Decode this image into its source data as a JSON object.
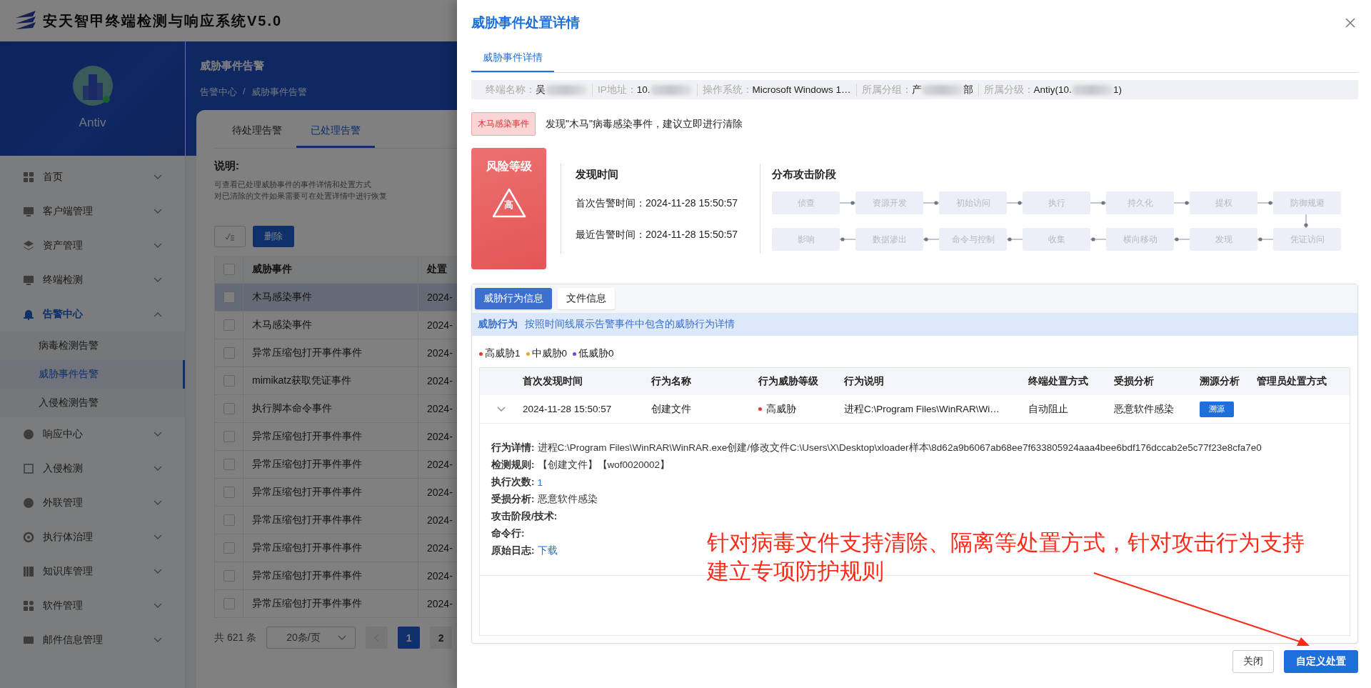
{
  "app": {
    "title": "安天智甲终端检测与响应系统V5.0",
    "user": "Antiv"
  },
  "sidebar": {
    "items": [
      {
        "label": "首页",
        "expanded": false,
        "selected": false
      },
      {
        "label": "客户端管理",
        "expanded": false,
        "selected": false
      },
      {
        "label": "资产管理",
        "expanded": false,
        "selected": false
      },
      {
        "label": "终端检测",
        "expanded": false,
        "selected": false
      },
      {
        "label": "告警中心",
        "expanded": true,
        "selected": true,
        "children": [
          {
            "label": "病毒检测告警",
            "selected": false
          },
          {
            "label": "威胁事件告警",
            "selected": true
          },
          {
            "label": "入侵检测告警",
            "selected": false
          }
        ]
      },
      {
        "label": "响应中心",
        "expanded": false,
        "selected": false
      },
      {
        "label": "入侵检测",
        "expanded": false,
        "selected": false
      },
      {
        "label": "外联管理",
        "expanded": false,
        "selected": false
      },
      {
        "label": "执行体治理",
        "expanded": false,
        "selected": false
      },
      {
        "label": "知识库管理",
        "expanded": false,
        "selected": false
      },
      {
        "label": "软件管理",
        "expanded": false,
        "selected": false
      },
      {
        "label": "邮件信息管理",
        "expanded": false,
        "selected": false
      }
    ]
  },
  "page": {
    "title": "威胁事件告警",
    "breadcrumb": [
      "告警中心",
      "威胁事件告警"
    ],
    "breadcrumb_separator": "/",
    "tabs": [
      {
        "label": "待处理告警",
        "selected": false
      },
      {
        "label": "已处理告警",
        "selected": true
      }
    ],
    "note_title": "说明:",
    "note_lines": [
      "可查看已处理威胁事件的事件详情和处置方式",
      "对已清除的文件如果需要可在处置详情中进行恢复"
    ],
    "delete_button": "删除",
    "table": {
      "columns": [
        "威胁事件",
        "处置"
      ],
      "all_checked": false,
      "rows": [
        {
          "event": "木马感染事件",
          "time": "2024-",
          "checked": false,
          "hovered": true
        },
        {
          "event": "木马感染事件",
          "time": "2024-",
          "checked": false,
          "hovered": false
        },
        {
          "event": "异常压缩包打开事件事件",
          "time": "2024-",
          "checked": false,
          "hovered": false
        },
        {
          "event": "mimikatz获取凭证事件",
          "time": "2024-",
          "checked": false,
          "hovered": false
        },
        {
          "event": "执行脚本命令事件",
          "time": "2024-",
          "checked": false,
          "hovered": false
        },
        {
          "event": "异常压缩包打开事件事件",
          "time": "2024-",
          "checked": false,
          "hovered": false
        },
        {
          "event": "异常压缩包打开事件事件",
          "time": "2024-",
          "checked": false,
          "hovered": false
        },
        {
          "event": "异常压缩包打开事件事件",
          "time": "2024-",
          "checked": false,
          "hovered": false
        },
        {
          "event": "异常压缩包打开事件事件",
          "time": "2024-",
          "checked": false,
          "hovered": false
        },
        {
          "event": "异常压缩包打开事件事件",
          "time": "2024-",
          "checked": false,
          "hovered": false
        },
        {
          "event": "异常压缩包打开事件事件",
          "time": "2024-",
          "checked": false,
          "hovered": false
        },
        {
          "event": "异常压缩包打开事件事件",
          "time": "2024-",
          "checked": false,
          "hovered": false
        }
      ]
    },
    "pagination": {
      "total": "共 621 条",
      "page_size": "20条/页",
      "pages": [
        {
          "label": "1",
          "selected": true
        },
        {
          "label": "2",
          "selected": false
        }
      ]
    }
  },
  "drawer": {
    "title": "威胁事件处置详情",
    "tabs": [
      {
        "label": "威胁事件详情",
        "selected": true
      }
    ],
    "info": [
      {
        "label": "终端名称：",
        "value": "吴",
        "redacted": true
      },
      {
        "label": "IP地址：",
        "value": "10.",
        "redacted": true
      },
      {
        "label": "操作系统：",
        "value": "Microsoft Windows 1…"
      },
      {
        "label": "所属分组：",
        "value": "产",
        "redacted": true,
        "tail": "部"
      },
      {
        "label": "所属分级：",
        "value": "Antiy(10.",
        "redacted": true,
        "tail": "1)"
      }
    ],
    "tag": "木马感染事件",
    "message": "发现\"木马\"病毒感染事件，建议立即进行清除",
    "risk": {
      "title": "风险等级",
      "level": "高"
    },
    "times": {
      "title": "发现时间",
      "first": "首次告警时间：2024-11-28 15:50:57",
      "last": "最近告警时间：2024-11-28 15:50:57"
    },
    "stages": {
      "title": "分布攻击阶段",
      "row_1": [
        "侦查",
        "资源开发",
        "初始访问",
        "执行",
        "持久化",
        "提权",
        "防御规避"
      ],
      "row_2": [
        "影响",
        "数据渗出",
        "命令与控制",
        "收集",
        "横向移动",
        "发现",
        "凭证访问"
      ]
    },
    "panel": {
      "tabs": [
        {
          "label": "威胁行为信息",
          "selected": true
        },
        {
          "label": "文件信息",
          "selected": false
        }
      ],
      "banner_title": "威胁行为",
      "banner_text": "按照时间线展示告警事件中包含的威胁行为详情",
      "levels": [
        {
          "label": "高威胁1",
          "color": "#e53935"
        },
        {
          "label": "中威胁0",
          "color": "#f5a623"
        },
        {
          "label": "低威胁0",
          "color": "#7b3fe4"
        }
      ],
      "columns": [
        "首次发现时间",
        "行为名称",
        "行为威胁等级",
        "行为说明",
        "终端处置方式",
        "受损分析",
        "溯源分析",
        "管理员处置方式"
      ],
      "rows": [
        {
          "expanded": true,
          "first_time": "2024-11-28 15:50:57",
          "name": "创建文件",
          "level": "高威胁",
          "color": "#e53935",
          "description": "进程C:\\Program Files\\WinRAR\\Wi…",
          "terminal_action": "自动阻止",
          "damage": "恶意软件感染",
          "trace_button": "溯源",
          "details": [
            {
              "label": "行为详情:",
              "value": "进程C:\\Program Files\\WinRAR\\WinRAR.exe创建/修改文件C:\\Users\\X\\Desktop\\xloader样本\\8d62a9b6067ab68ee7f633805924aaa4bee6bdf176dccab2e5c77f23e8cfa7e0",
              "kind": "text"
            },
            {
              "label": "检测规则:",
              "value": "【创建文件】【wof0020002】",
              "kind": "text"
            },
            {
              "label": "执行次数:",
              "value": "1",
              "kind": "count"
            },
            {
              "label": "受损分析:",
              "value": "恶意软件感染",
              "kind": "text"
            },
            {
              "label": "攻击阶段/技术:"
            },
            {
              "label": "命令行:"
            },
            {
              "label": "原始日志:",
              "value": "下载",
              "kind": "link"
            }
          ]
        }
      ]
    },
    "annotation": "针对病毒文件支持清除、隔离等处置方式，针对攻击行为支持建立专项防护规则",
    "buttons": [
      {
        "label": "关闭",
        "kind": "default"
      },
      {
        "label": "自定义处置",
        "kind": "primary"
      }
    ]
  }
}
